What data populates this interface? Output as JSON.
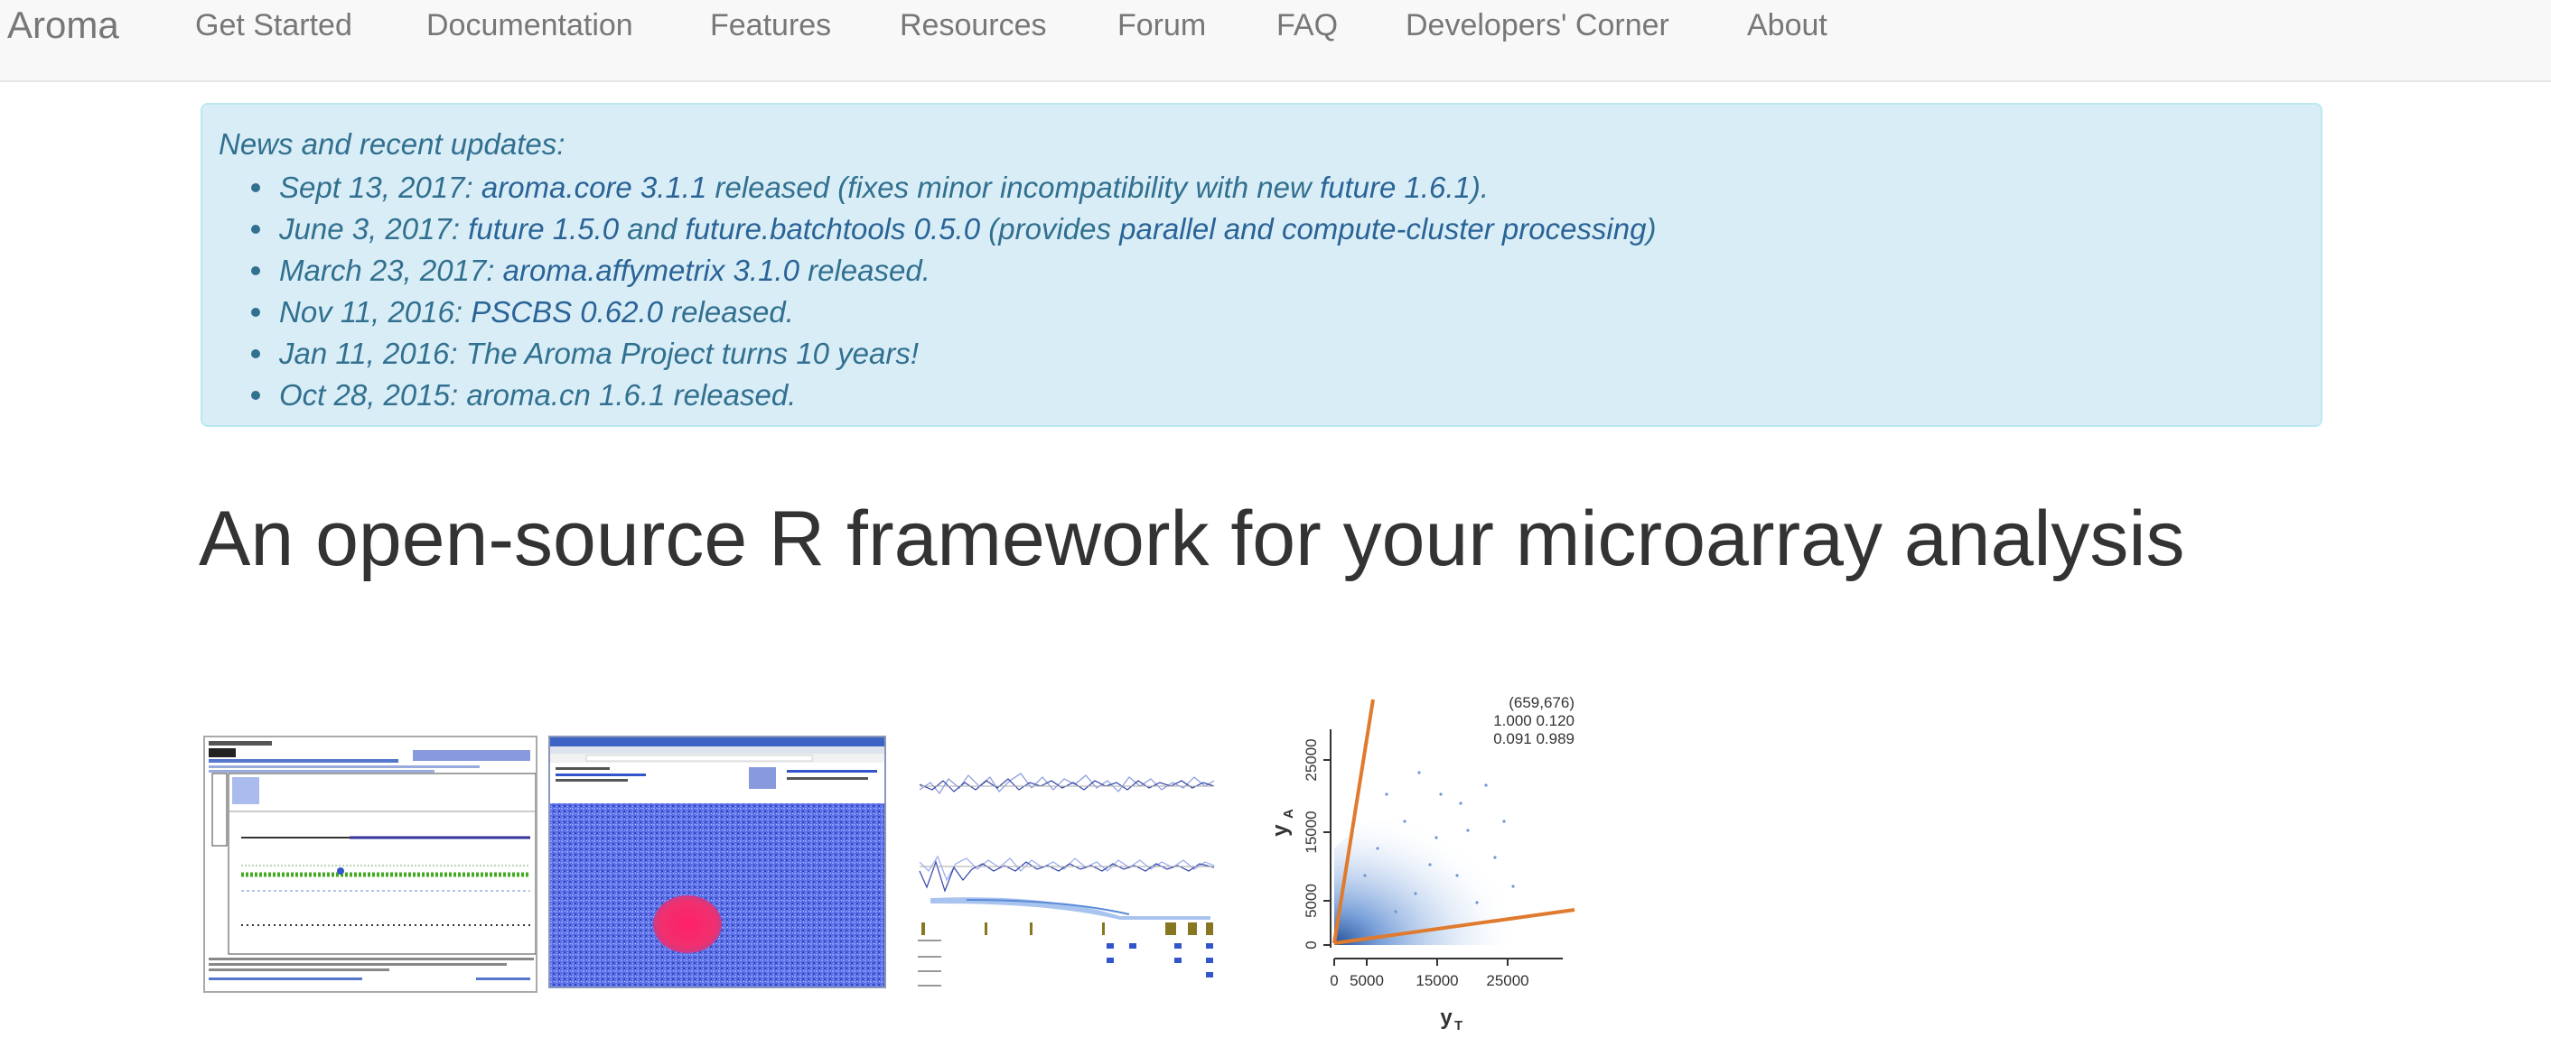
{
  "navbar": {
    "brand": "Aroma",
    "items": [
      {
        "label": "Get Started"
      },
      {
        "label": "Documentation"
      },
      {
        "label": "Features"
      },
      {
        "label": "Resources"
      },
      {
        "label": "Forum"
      },
      {
        "label": "FAQ"
      },
      {
        "label": "Developers' Corner"
      },
      {
        "label": "About"
      }
    ]
  },
  "news": {
    "title": "News and recent updates:",
    "items": [
      {
        "date": "Sept 13, 2017:",
        "link1": "aroma.core 3.1.1",
        "mid1": " released (fixes minor incompatibility with new ",
        "link2": "future 1.6.1",
        "end": ")."
      },
      {
        "date": "June 3, 2017:",
        "link1": "future 1.5.0",
        "mid1": " and ",
        "link2": "future.batchtools 0.5.0",
        "mid2": " (provides ",
        "link3": "parallel and compute-cluster processing",
        "end": ")"
      },
      {
        "date": "March 23, 2017:",
        "link1": "aroma.affymetrix 3.1.0",
        "end": " released."
      },
      {
        "date": "Nov 11, 2016:",
        "link1": "PSCBS 0.62.0",
        "end": " released."
      },
      {
        "date": "Jan 11, 2016:",
        "text": "The Aroma Project turns 10 years!"
      },
      {
        "date": "Oct 28, 2015:",
        "text": "aroma.cn 1.6.1 released."
      }
    ]
  },
  "headline": "An open-source R framework for your microarray analysis",
  "thumbnails": {
    "scatter": {
      "annotation_line1": "(659,676)",
      "annotation_line2": "1.000  0.120",
      "annotation_line3": "0.091  0.989",
      "ylabel": "y",
      "ylabel_sub": "A",
      "xlabel": "y",
      "xlabel_sub": "T",
      "yticks": [
        "0",
        "5000",
        "15000",
        "25000"
      ],
      "xticks": [
        "0",
        "5000",
        "15000",
        "25000"
      ]
    }
  },
  "colors": {
    "navbar_bg": "#f8f8f8",
    "news_bg": "#d9edf7",
    "news_text": "#31708f",
    "link": "#2a6496",
    "fit_line": "#e07a2e"
  }
}
